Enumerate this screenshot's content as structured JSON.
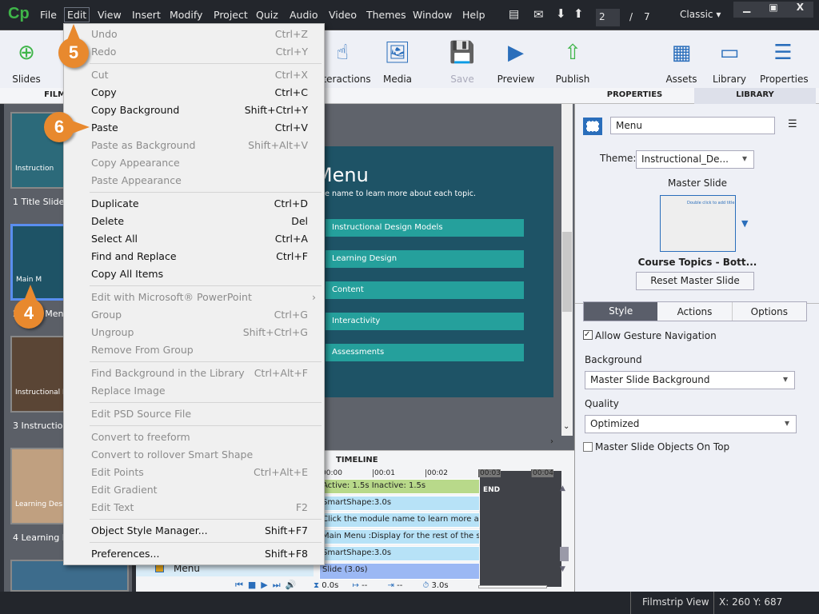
{
  "app": {
    "logo": "Cp",
    "menus": [
      "File",
      "Edit",
      "View",
      "Insert",
      "Modify",
      "Project",
      "Quiz",
      "Audio",
      "Video",
      "Themes",
      "Window",
      "Help"
    ],
    "page_current": "2",
    "page_sep": "/",
    "page_total": "7",
    "workspace": "Classic",
    "window_controls": [
      "minimize",
      "maximize",
      "close"
    ]
  },
  "toolbar": {
    "slides": "Slides",
    "interactions": "Interactions",
    "media": "Media",
    "save": "Save",
    "preview": "Preview",
    "publish": "Publish",
    "assets": "Assets",
    "library": "Library",
    "properties": "Properties"
  },
  "panels": {
    "filmstrip": "FILMSTRIP",
    "properties": "PROPERTIES",
    "library": "LIBRARY",
    "timeline": "TIMELINE"
  },
  "filmstrip": [
    {
      "label": "1 Title Slide",
      "caption": "Instruction"
    },
    {
      "label": "2 Main Menu",
      "caption": "Main M"
    },
    {
      "label": "3 Instructional Design Models",
      "caption": "Instructional Design M"
    },
    {
      "label": "4 Learning Design",
      "caption": "Learning Design"
    }
  ],
  "slide": {
    "title": "Main Menu",
    "subtitle": "Click the module name to learn more about each topic.",
    "buttons": [
      "Instructional Design Models",
      "Learning Design",
      "Content",
      "Interactivity",
      "Assessments"
    ]
  },
  "timeline": {
    "ticks": [
      "00:00",
      "00:01",
      "00:02",
      "00:03",
      "00:04"
    ],
    "rows": [
      "Active: 1.5s    Inactive: 1.5s",
      "SmartShape:3.0s",
      "Click the module name to learn more about...",
      "Main Menu :Display for the rest of the slide",
      "SmartShape:3.0s",
      "Slide (3.0s)"
    ],
    "end": "END",
    "layer": "Menu",
    "time_current": "0.0s",
    "time_start": "--",
    "time_end": "--",
    "duration": "3.0s"
  },
  "properties": {
    "name": "Menu",
    "theme_label": "Theme:",
    "theme": "Instructional_De...",
    "master_slide_label": "Master Slide",
    "master_thumb_text": "Double click to add title",
    "master_slide_name": "Course Topics - Bott...",
    "reset_button": "Reset Master Slide",
    "tabs": [
      "Style",
      "Actions",
      "Options"
    ],
    "active_tab": "Style",
    "allow_gesture": "Allow Gesture Navigation",
    "allow_gesture_checked": true,
    "background_label": "Background",
    "background": "Master Slide Background",
    "quality_label": "Quality",
    "quality": "Optimized",
    "master_on_top": "Master Slide Objects On Top",
    "master_on_top_checked": false
  },
  "status": {
    "view": "Filmstrip View",
    "coords": "X: 260 Y: 687"
  },
  "callouts": [
    "5",
    "6",
    "4"
  ],
  "menu": {
    "items": [
      {
        "label": "Undo",
        "shortcut": "Ctrl+Z",
        "disabled": true
      },
      {
        "label": "Redo",
        "shortcut": "Ctrl+Y",
        "disabled": true
      },
      {
        "sep": true
      },
      {
        "label": "Cut",
        "shortcut": "Ctrl+X",
        "disabled": true
      },
      {
        "label": "Copy",
        "shortcut": "Ctrl+C"
      },
      {
        "label": "Copy Background",
        "shortcut": "Shift+Ctrl+Y"
      },
      {
        "label": "Paste",
        "shortcut": "Ctrl+V"
      },
      {
        "label": "Paste as Background",
        "shortcut": "Shift+Alt+V",
        "disabled": true
      },
      {
        "label": "Copy Appearance",
        "shortcut": "",
        "disabled": true
      },
      {
        "label": "Paste Appearance",
        "shortcut": "",
        "disabled": true
      },
      {
        "sep": true
      },
      {
        "label": "Duplicate",
        "shortcut": "Ctrl+D"
      },
      {
        "label": "Delete",
        "shortcut": "Del"
      },
      {
        "label": "Select All",
        "shortcut": "Ctrl+A"
      },
      {
        "label": "Find and Replace",
        "shortcut": "Ctrl+F"
      },
      {
        "label": "Copy All Items",
        "shortcut": ""
      },
      {
        "sep": true
      },
      {
        "label": "Edit with Microsoft® PowerPoint",
        "shortcut": "",
        "disabled": true,
        "submenu": true
      },
      {
        "label": "Group",
        "shortcut": "Ctrl+G",
        "disabled": true
      },
      {
        "label": "Ungroup",
        "shortcut": "Shift+Ctrl+G",
        "disabled": true
      },
      {
        "label": "Remove From Group",
        "shortcut": "",
        "disabled": true
      },
      {
        "sep": true
      },
      {
        "label": "Find Background in the Library",
        "shortcut": "Ctrl+Alt+F",
        "disabled": true
      },
      {
        "label": "Replace Image",
        "shortcut": "",
        "disabled": true
      },
      {
        "sep": true
      },
      {
        "label": "Edit PSD Source File",
        "shortcut": "",
        "disabled": true
      },
      {
        "sep": true
      },
      {
        "label": "Convert to freeform",
        "shortcut": "",
        "disabled": true
      },
      {
        "label": "Convert to rollover Smart Shape",
        "shortcut": "",
        "disabled": true
      },
      {
        "label": "Edit Points",
        "shortcut": "Ctrl+Alt+E",
        "disabled": true
      },
      {
        "label": "Edit Gradient",
        "shortcut": "",
        "disabled": true
      },
      {
        "label": "Edit Text",
        "shortcut": "F2",
        "disabled": true
      },
      {
        "sep": true
      },
      {
        "label": "Object Style Manager...",
        "shortcut": "Shift+F7"
      },
      {
        "sep": true
      },
      {
        "label": "Preferences...",
        "shortcut": "Shift+F8"
      }
    ]
  }
}
